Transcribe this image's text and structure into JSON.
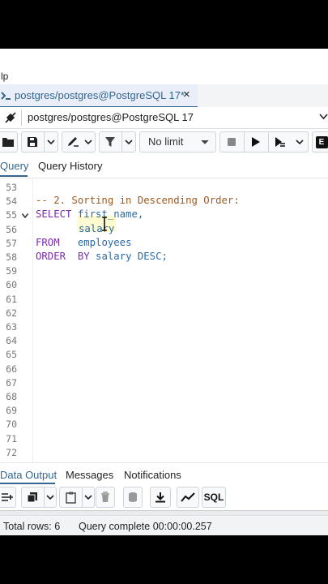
{
  "menu": {
    "help_label": "lp"
  },
  "query_tab": {
    "title": "postgres/postgres@PostgreSQL 17*",
    "close_glyph": "×"
  },
  "connection": {
    "selected": "postgres/postgres@PostgreSQL 17"
  },
  "toolbar": {
    "limit_value": "No limit",
    "truncated_button_glyph": "E"
  },
  "editor_tabs": [
    {
      "label": "Query"
    },
    {
      "label": "Query History"
    }
  ],
  "editor": {
    "line_numbers": [
      "53",
      "54",
      "55",
      "56",
      "57",
      "58",
      "59",
      "60",
      "61",
      "62",
      "63",
      "64",
      "65",
      "66",
      "67",
      "68",
      "69",
      "70",
      "71",
      "72"
    ],
    "comment": "-- 2. Sorting in Descending Order:",
    "kw_select": "SELECT",
    "col_first_name": "first_name,",
    "col_salary": "salary",
    "kw_from": "FROM",
    "table": "employees",
    "kw_order_by": "ORDER  BY",
    "order_expr": "salary DESC;"
  },
  "output_tabs": [
    {
      "label": "Data Output"
    },
    {
      "label": "Messages"
    },
    {
      "label": "Notifications"
    }
  ],
  "output_toolbar": {
    "sql_label": "SQL"
  },
  "status": {
    "total_rows": "Total rows: 6",
    "query_complete": "Query complete 00:00:00.257"
  },
  "colors": {
    "accent": "#326690",
    "keyword": "#7a2bb0",
    "identifier": "#2a6aa8",
    "comment": "#a0581c"
  }
}
